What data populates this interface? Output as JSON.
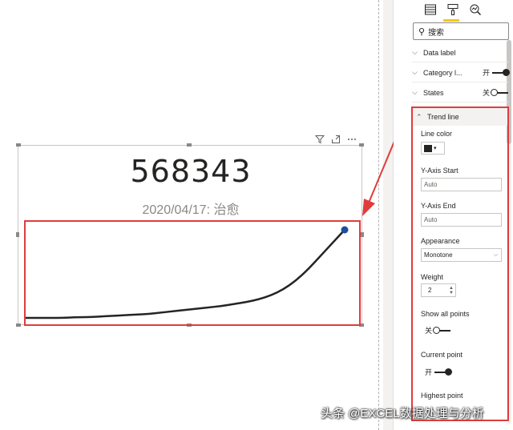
{
  "visual": {
    "kpi_value": "568343",
    "kpi_label": "2020/04/17: 治愈",
    "icons": [
      "filter-icon",
      "focus-mode-icon",
      "more-options-icon"
    ],
    "trend": {
      "y": [
        2,
        2,
        2,
        2,
        3,
        3,
        4,
        5,
        6,
        7,
        8,
        10,
        12,
        14,
        16,
        18,
        20,
        23,
        26,
        30,
        36,
        45,
        58,
        75,
        95,
        115,
        135
      ],
      "line_color": "#252423",
      "point_color": "#1f4e9e"
    }
  },
  "pane": {
    "tabs": [
      "fields-icon",
      "format-icon",
      "analytics-icon"
    ],
    "accent": "#f2c811",
    "search_placeholder": "搜索",
    "sections": [
      {
        "label": "Data label",
        "toggle": ""
      },
      {
        "label": "Category l...",
        "toggle": "开"
      },
      {
        "label": "States",
        "toggle": "关"
      }
    ],
    "trend_line": {
      "header": "Trend line",
      "line_color_label": "Line color",
      "line_color_value": "#252423",
      "y_start_label": "Y-Axis Start",
      "y_start_placeholder": "Auto",
      "y_end_label": "Y-Axis End",
      "y_end_placeholder": "Auto",
      "appearance_label": "Appearance",
      "appearance_value": "Monotone",
      "weight_label": "Weight",
      "weight_value": "2",
      "show_all_points_label": "Show all points",
      "show_all_points_toggle": "关",
      "current_point_label": "Current point",
      "current_point_toggle": "开",
      "highest_point_label": "Highest point"
    }
  },
  "highlight_color": "#e03c3c",
  "watermark": "头条 @EXCEL数据处理与分析"
}
